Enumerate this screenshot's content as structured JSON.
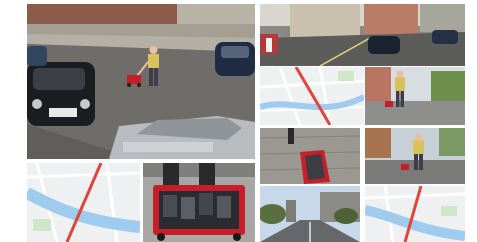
{
  "collage": {
    "background": "#ffffff",
    "tiles": [
      {
        "subject": "street-scene-man-pulling-red-wagon-parked-cars"
      },
      {
        "subject": "street-scene-buildings-parked-cars"
      },
      {
        "subject": "map-blue-river-red-traffic-line"
      },
      {
        "subject": "man-with-red-wagon-on-sidewalk"
      },
      {
        "subject": "map-blue-river-red-traffic-line"
      },
      {
        "subject": "red-wagon-full-of-phones-top-view"
      },
      {
        "subject": "red-wagon-on-cobblestone"
      },
      {
        "subject": "man-pulling-red-wagon-street"
      },
      {
        "subject": "city-street-with-trees"
      },
      {
        "subject": "map-river-red-traffic-line"
      }
    ]
  },
  "colors": {
    "wagon_red": "#c81e2a",
    "river_blue": "#9ecbee",
    "traffic_red": "#e0453a",
    "map_bg": "#eef0f2",
    "asphalt": "#6b6a66",
    "shirt_yellow": "#d9c25a"
  }
}
